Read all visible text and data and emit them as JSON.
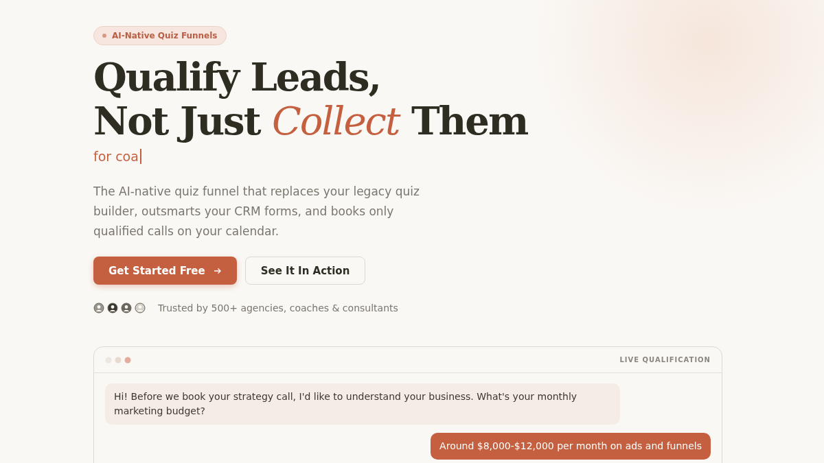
{
  "badge": {
    "label": "AI-Native Quiz Funnels"
  },
  "headline": {
    "line_1": "Qualify Leads,",
    "line_2_start": "Not Just",
    "line_2_accent": "Collect",
    "line_2_end": "Them"
  },
  "typing_text": "for coa",
  "description": "The AI-native quiz funnel that replaces your legacy quiz builder, outsmarts your CRM forms, and books only qualified calls on your calendar.",
  "buttons": [
    {
      "label": "Get Started Free",
      "kind": "primary"
    },
    {
      "label": "See It In Action",
      "kind": "secondary"
    }
  ],
  "social_proof": {
    "avatars": [
      {
        "kind": "light"
      },
      {
        "kind": "dark"
      },
      {
        "kind": "medium"
      },
      {
        "kind": "outline"
      }
    ],
    "text": "Trusted by 500+ agencies, coaches & consultants"
  },
  "chat_window": {
    "title": "LIVE QUALIFICATION",
    "messages": [
      {
        "kind": "bot",
        "text": "Hi! Before we book your strategy call, I'd like to understand your business. What's your monthly marketing budget?"
      },
      {
        "kind": "user",
        "text": "Around $8,000-$12,000 per month on ads and funnels"
      }
    ]
  }
}
